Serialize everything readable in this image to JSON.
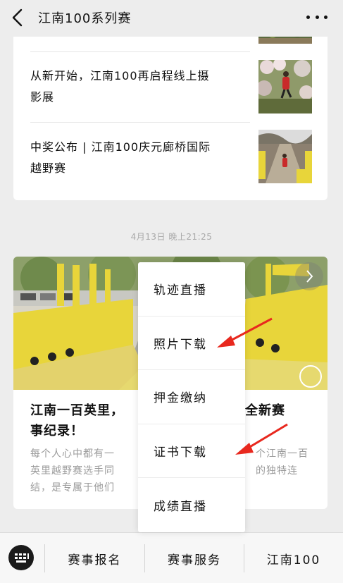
{
  "header": {
    "title": "江南100系列赛",
    "back_icon": "chevron-left-icon",
    "more_icon": "more-dots-icon"
  },
  "feed": {
    "articles": [
      {
        "title": "从新开始，江南100再启程线上摄影展",
        "line1": "从新开始，江南100再启程线上摄",
        "line2": "影展"
      },
      {
        "title": "中奖公布 | 江南100庆元廊桥国际越野赛",
        "line1": "中奖公布 | 江南100庆元廊桥国际",
        "line2": "越野赛"
      }
    ],
    "timestamp": "4月13日  晚上21:25",
    "featured": {
      "headline": "江南一百英里，一起见证创造全新赛事纪录！",
      "headline_line1": "江南一百英里，",
      "headline_line1_end": "造全新赛",
      "headline_line2": "事纪录！",
      "summary_line1": "每个人心中都有一",
      "summary_line1_end": "个江南一百",
      "summary_line2": "英里越野赛选手同",
      "summary_line2_end": "的独特连",
      "summary_line3": "结，是专属于他们"
    }
  },
  "menu": {
    "items": [
      "轨迹直播",
      "照片下载",
      "押金缴纳",
      "证书下载",
      "成绩直播"
    ]
  },
  "tabbar": {
    "keyboard_icon": "keyboard-icon",
    "tabs": [
      "赛事报名",
      "赛事服务",
      "江南100"
    ]
  },
  "colors": {
    "accent_yellow": "#e8d53a",
    "arrow_red": "#e8281e",
    "background": "#ededed"
  }
}
